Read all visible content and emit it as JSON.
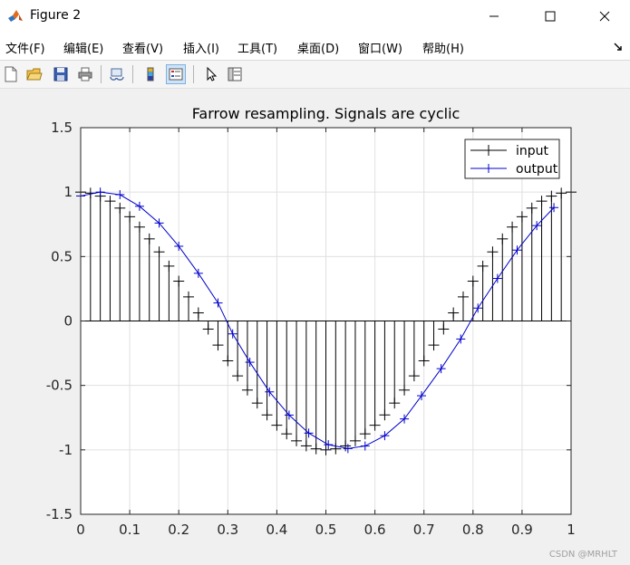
{
  "window": {
    "title": "Figure 2",
    "minimize_icon": "minimize-icon",
    "maximize_icon": "maximize-icon",
    "close_icon": "close-icon"
  },
  "menu": {
    "items": [
      {
        "label": "文件(F)"
      },
      {
        "label": "编辑(E)"
      },
      {
        "label": "查看(V)"
      },
      {
        "label": "插入(I)"
      },
      {
        "label": "工具(T)"
      },
      {
        "label": "桌面(D)"
      },
      {
        "label": "窗口(W)"
      },
      {
        "label": "帮助(H)"
      }
    ]
  },
  "toolbar": {
    "icons": [
      "new-figure-icon",
      "open-file-icon",
      "save-icon",
      "print-icon",
      "link-plot-icon",
      "colorbar-icon",
      "legend-icon",
      "pointer-icon",
      "property-inspector-icon"
    ]
  },
  "watermark": "CSDN @MRHLT",
  "colors": {
    "input": "#000000",
    "output": "#0000cc",
    "grid": "#e0e0e0"
  },
  "chart_data": {
    "type": "line",
    "title": "Farrow resampling. Signals are cyclic",
    "xlabel": "",
    "ylabel": "",
    "xlim": [
      0,
      1
    ],
    "ylim": [
      -1.5,
      1.5
    ],
    "xticks": [
      "0",
      "0.1",
      "0.2",
      "0.3",
      "0.4",
      "0.5",
      "0.6",
      "0.7",
      "0.8",
      "0.9",
      "1"
    ],
    "yticks": [
      "1.5",
      "1",
      "0.5",
      "0",
      "-0.5",
      "-1",
      "-1.5"
    ],
    "grid": true,
    "legend": {
      "location": "top-right",
      "entries": [
        "input",
        "output"
      ]
    },
    "series": [
      {
        "name": "input",
        "style": "stem",
        "marker": "+",
        "x": [
          0,
          0.02,
          0.04,
          0.06,
          0.08,
          0.1,
          0.12,
          0.14,
          0.16,
          0.18,
          0.2,
          0.22,
          0.24,
          0.26,
          0.28,
          0.3,
          0.32,
          0.34,
          0.36,
          0.38,
          0.4,
          0.42,
          0.44,
          0.46,
          0.48,
          0.5,
          0.52,
          0.54,
          0.56,
          0.58,
          0.6,
          0.62,
          0.64,
          0.66,
          0.68,
          0.7,
          0.72,
          0.74,
          0.76,
          0.78,
          0.8,
          0.82,
          0.84,
          0.86,
          0.88,
          0.9,
          0.92,
          0.94,
          0.96,
          0.98,
          1.0
        ],
        "y": [
          1.0,
          0.992,
          0.969,
          0.93,
          0.876,
          0.809,
          0.729,
          0.637,
          0.536,
          0.426,
          0.309,
          0.187,
          0.063,
          -0.063,
          -0.187,
          -0.309,
          -0.426,
          -0.536,
          -0.637,
          -0.729,
          -0.809,
          -0.876,
          -0.93,
          -0.969,
          -0.992,
          -1.0,
          -0.992,
          -0.969,
          -0.93,
          -0.876,
          -0.809,
          -0.729,
          -0.637,
          -0.536,
          -0.426,
          -0.309,
          -0.187,
          -0.063,
          0.063,
          0.187,
          0.309,
          0.426,
          0.536,
          0.637,
          0.729,
          0.809,
          0.876,
          0.93,
          0.969,
          0.992,
          1.0
        ]
      },
      {
        "name": "output",
        "style": "line",
        "marker": "+",
        "x": [
          0,
          0.04,
          0.08,
          0.12,
          0.16,
          0.2,
          0.24,
          0.28,
          0.31,
          0.345,
          0.385,
          0.425,
          0.465,
          0.505,
          0.545,
          0.58,
          0.62,
          0.66,
          0.695,
          0.735,
          0.775,
          0.81,
          0.85,
          0.89,
          0.93,
          0.965
        ],
        "y": [
          0.97,
          1.0,
          0.98,
          0.89,
          0.76,
          0.58,
          0.37,
          0.14,
          -0.1,
          -0.32,
          -0.55,
          -0.73,
          -0.87,
          -0.96,
          -0.99,
          -0.97,
          -0.89,
          -0.76,
          -0.58,
          -0.37,
          -0.14,
          0.1,
          0.33,
          0.55,
          0.74,
          0.88
        ]
      }
    ]
  }
}
